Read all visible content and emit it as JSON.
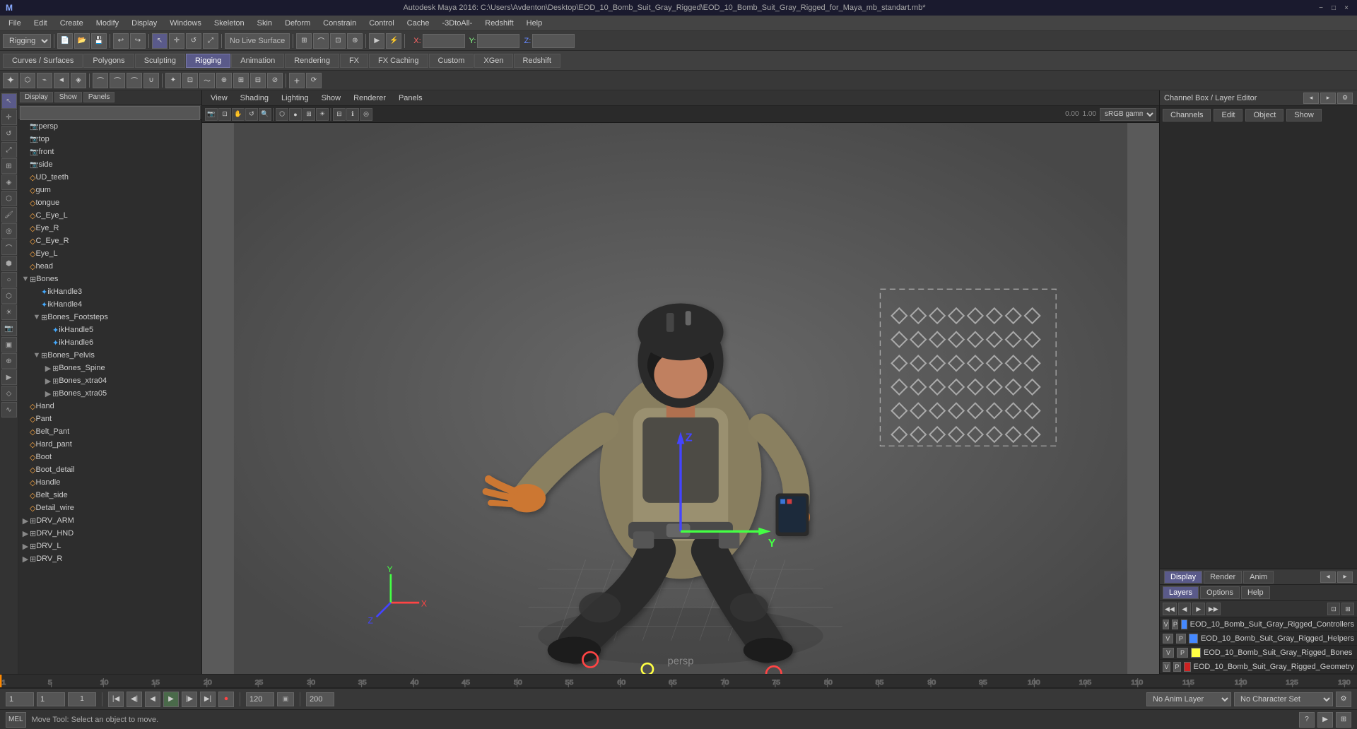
{
  "titlebar": {
    "title": "Autodesk Maya 2016: C:\\Users\\Avdenton\\Desktop\\EOD_10_Bomb_Suit_Gray_Rigged\\EOD_10_Bomb_Suit_Gray_Rigged_for_Maya_mb_standart.mb*",
    "min_label": "−",
    "max_label": "□",
    "close_label": "×"
  },
  "menubar": {
    "items": [
      "File",
      "Edit",
      "Create",
      "Modify",
      "Display",
      "Windows",
      "Skeleton",
      "Skin",
      "Deform",
      "Constrain",
      "Control",
      "Cache",
      "-3DtoAll-",
      "Redshift",
      "Help"
    ]
  },
  "toolbar1": {
    "mode_select": "Rigging",
    "live_surface_label": "No Live Surface",
    "x_label": "X:",
    "y_label": "Y:",
    "z_label": "Z:"
  },
  "toolbar2": {
    "tabs": [
      "Curves / Surfaces",
      "Polygons",
      "Sculpting",
      "Rigging",
      "Animation",
      "Rendering",
      "FX",
      "FX Caching",
      "Custom",
      "XGen",
      "Redshift"
    ]
  },
  "outliner": {
    "search_placeholder": "",
    "items": [
      {
        "id": "persp",
        "label": "persp",
        "type": "cam",
        "indent": 0,
        "expand": false
      },
      {
        "id": "top",
        "label": "top",
        "type": "cam",
        "indent": 0,
        "expand": false
      },
      {
        "id": "front",
        "label": "front",
        "type": "cam",
        "indent": 0,
        "expand": false
      },
      {
        "id": "side",
        "label": "side",
        "type": "cam",
        "indent": 0,
        "expand": false
      },
      {
        "id": "UD_teeth",
        "label": "UD_teeth",
        "type": "mesh",
        "indent": 0,
        "expand": false
      },
      {
        "id": "gum",
        "label": "gum",
        "type": "mesh",
        "indent": 0,
        "expand": false
      },
      {
        "id": "tongue",
        "label": "tongue",
        "type": "mesh",
        "indent": 0,
        "expand": false
      },
      {
        "id": "C_Eye_L",
        "label": "C_Eye_L",
        "type": "mesh",
        "indent": 0,
        "expand": false
      },
      {
        "id": "Eye_R",
        "label": "Eye_R",
        "type": "mesh",
        "indent": 0,
        "expand": false
      },
      {
        "id": "C_Eye_R",
        "label": "C_Eye_R",
        "type": "mesh",
        "indent": 0,
        "expand": false
      },
      {
        "id": "Eye_L",
        "label": "Eye_L",
        "type": "mesh",
        "indent": 0,
        "expand": false
      },
      {
        "id": "head",
        "label": "head",
        "type": "mesh",
        "indent": 0,
        "expand": false
      },
      {
        "id": "Bones",
        "label": "Bones",
        "type": "group",
        "indent": 0,
        "expand": true
      },
      {
        "id": "ikHandle3",
        "label": "ikHandle3",
        "type": "joint",
        "indent": 1,
        "expand": false
      },
      {
        "id": "ikHandle4",
        "label": "ikHandle4",
        "type": "joint",
        "indent": 1,
        "expand": false
      },
      {
        "id": "Bones_Footsteps",
        "label": "Bones_Footsteps",
        "type": "group",
        "indent": 1,
        "expand": true
      },
      {
        "id": "ikHandle5",
        "label": "ikHandle5",
        "type": "joint",
        "indent": 2,
        "expand": false
      },
      {
        "id": "ikHandle6",
        "label": "ikHandle6",
        "type": "joint",
        "indent": 2,
        "expand": false
      },
      {
        "id": "Bones_Pelvis",
        "label": "Bones_Pelvis",
        "type": "group",
        "indent": 1,
        "expand": true
      },
      {
        "id": "Bones_Spine",
        "label": "Bones_Spine",
        "type": "group",
        "indent": 2,
        "expand": false
      },
      {
        "id": "Bones_xtra04",
        "label": "Bones_xtra04",
        "type": "group",
        "indent": 2,
        "expand": false
      },
      {
        "id": "Bones_xtra05",
        "label": "Bones_xtra05",
        "type": "group",
        "indent": 2,
        "expand": false
      },
      {
        "id": "Hand",
        "label": "Hand",
        "type": "mesh",
        "indent": 0,
        "expand": false
      },
      {
        "id": "Pant",
        "label": "Pant",
        "type": "mesh",
        "indent": 0,
        "expand": false
      },
      {
        "id": "Belt_Pant",
        "label": "Belt_Pant",
        "type": "mesh",
        "indent": 0,
        "expand": false
      },
      {
        "id": "Hard_pant",
        "label": "Hard_pant",
        "type": "mesh",
        "indent": 0,
        "expand": false
      },
      {
        "id": "Boot",
        "label": "Boot",
        "type": "mesh",
        "indent": 0,
        "expand": false
      },
      {
        "id": "Boot_detail",
        "label": "Boot_detail",
        "type": "mesh",
        "indent": 0,
        "expand": false
      },
      {
        "id": "Handle",
        "label": "Handle",
        "type": "mesh",
        "indent": 0,
        "expand": false
      },
      {
        "id": "Belt_side",
        "label": "Belt_side",
        "type": "mesh",
        "indent": 0,
        "expand": false
      },
      {
        "id": "Detail_wire",
        "label": "Detail_wire",
        "type": "mesh",
        "indent": 0,
        "expand": false
      },
      {
        "id": "DRV_ARM",
        "label": "DRV_ARM",
        "type": "group",
        "indent": 0,
        "expand": false
      },
      {
        "id": "DRV_HND",
        "label": "DRV_HND",
        "type": "group",
        "indent": 0,
        "expand": false
      },
      {
        "id": "DRV_L",
        "label": "DRV_L",
        "type": "group",
        "indent": 0,
        "expand": false
      },
      {
        "id": "DRV_R",
        "label": "DRV_R",
        "type": "group",
        "indent": 0,
        "expand": false
      }
    ]
  },
  "viewport": {
    "menu_items": [
      "View",
      "Shading",
      "Lighting",
      "Show",
      "Renderer",
      "Panels"
    ],
    "persp_label": "persp",
    "gamma_label": "sRGB gamma",
    "value1": "0.00",
    "value2": "1.00"
  },
  "channel_box": {
    "title": "Channel Box / Layer Editor",
    "tabs": [
      "Channels",
      "Edit",
      "Object",
      "Show"
    ]
  },
  "layer_editor": {
    "section_tabs": [
      "Display",
      "Render",
      "Anim"
    ],
    "sub_tabs": [
      "Layers",
      "Options",
      "Help"
    ],
    "layers": [
      {
        "v": "V",
        "p": "P",
        "color": "#4488ff",
        "name": "EOD_10_Bomb_Suit_Gray_Rigged_Controllers"
      },
      {
        "v": "V",
        "p": "P",
        "color": "#4488ff",
        "name": "EOD_10_Bomb_Suit_Gray_Rigged_Helpers"
      },
      {
        "v": "V",
        "p": "P",
        "color": "#ffff44",
        "name": "EOD_10_Bomb_Suit_Gray_Rigged_Bones"
      },
      {
        "v": "V",
        "p": "P",
        "color": "#cc2222",
        "name": "EOD_10_Bomb_Suit_Gray_Rigged_Geometry"
      }
    ]
  },
  "timeline": {
    "start": 1,
    "end": 200,
    "current": 1,
    "ticks": [
      5,
      10,
      15,
      20,
      25,
      30,
      35,
      40,
      45,
      50,
      55,
      60,
      65,
      70,
      75,
      80,
      85,
      90,
      95,
      100,
      105,
      110,
      115,
      120,
      125,
      130
    ]
  },
  "transport": {
    "start_frame": "1",
    "current_frame": "1",
    "tick_label": "1",
    "end_frame": "120",
    "end_frame2": "200",
    "anim_layer": "No Anim Layer",
    "char_set": "No Character Set",
    "play_back": "◀◀",
    "step_back": "◀|",
    "prev_frame": "◀",
    "play_back2": "▶",
    "next_frame": "▶|",
    "play_fwd": "▶▶",
    "record": "⏺"
  },
  "statusbar": {
    "message": "Move Tool: Select an object to move.",
    "script_mode": "MEL"
  },
  "icons": {
    "camera": "🎥",
    "mesh": "◇",
    "joint": "✦",
    "group": "▼",
    "expand_open": "▼",
    "expand_closed": "▶",
    "collapse": "▲"
  }
}
